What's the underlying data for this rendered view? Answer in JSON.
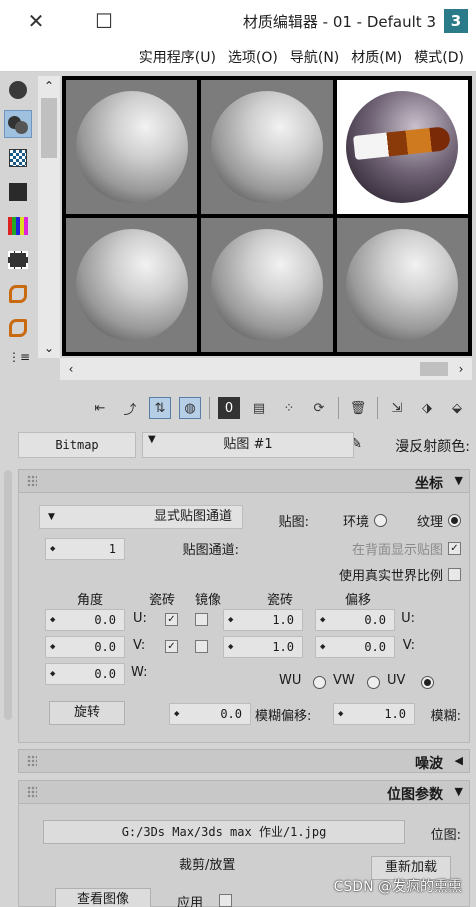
{
  "window": {
    "title": "3 材质编辑器 - 01 - Default",
    "logo_text": "3",
    "close_label": "✕",
    "maximize_label": "☐"
  },
  "menu": [
    "模式(D)",
    "材质(M)",
    "导航(N)",
    "选项(O)",
    "实用程序(U)"
  ],
  "toolbar_icons": [
    "show-map-icon",
    "show-end-result-icon",
    "background-icon",
    "select-by-material-icon",
    "options-icon",
    "reset-icon",
    "put-to-library-icon",
    "assign-icon",
    "delete-icon",
    "copy-icon",
    "get-material-icon"
  ],
  "material_id_label": "0",
  "diffuse": {
    "label": "漫反射颜色:",
    "map_name": "贴图 #1",
    "map_type": "Bitmap"
  },
  "coordinates": {
    "title": "坐标",
    "texture_label": "纹理",
    "environ_label": "环境",
    "mapping_label": "贴图:",
    "mapping_value": "显式贴图通道",
    "show_on_back_label": "在背面显示贴图",
    "map_channel_label": "贴图通道:",
    "map_channel_value": "1",
    "real_world_label": "使用真实世界比例",
    "offset_label": "偏移",
    "tiling_label": "瓷砖",
    "mirror_label": "镜像",
    "tile_label": "瓷砖",
    "angle_label": "角度",
    "u_label": "U:",
    "v_label": "V:",
    "w_label": "W:",
    "u_offset": "0.0",
    "v_offset": "0.0",
    "u_tiling": "1.0",
    "v_tiling": "1.0",
    "u_angle": "0.0",
    "v_angle": "0.0",
    "w_angle": "0.0",
    "uv_label": "UV",
    "vw_label": "VW",
    "wu_label": "WU",
    "blur_label": "模糊:",
    "blur_value": "1.0",
    "blur_offset_label": "模糊偏移:",
    "blur_offset_value": "0.0",
    "rotate_label": "旋转"
  },
  "noise": {
    "title": "噪波"
  },
  "bitmap_params": {
    "title": "位图参数",
    "bitmap_label": "位图:",
    "bitmap_path": "G:/3Ds Max/3ds max 作业/1.jpg",
    "reload_label": "重新加载",
    "crop_label": "裁剪/放置",
    "apply_label": "应用",
    "view_image_label": "查看图像"
  },
  "watermark": "CSDN @发疯的熏熏"
}
